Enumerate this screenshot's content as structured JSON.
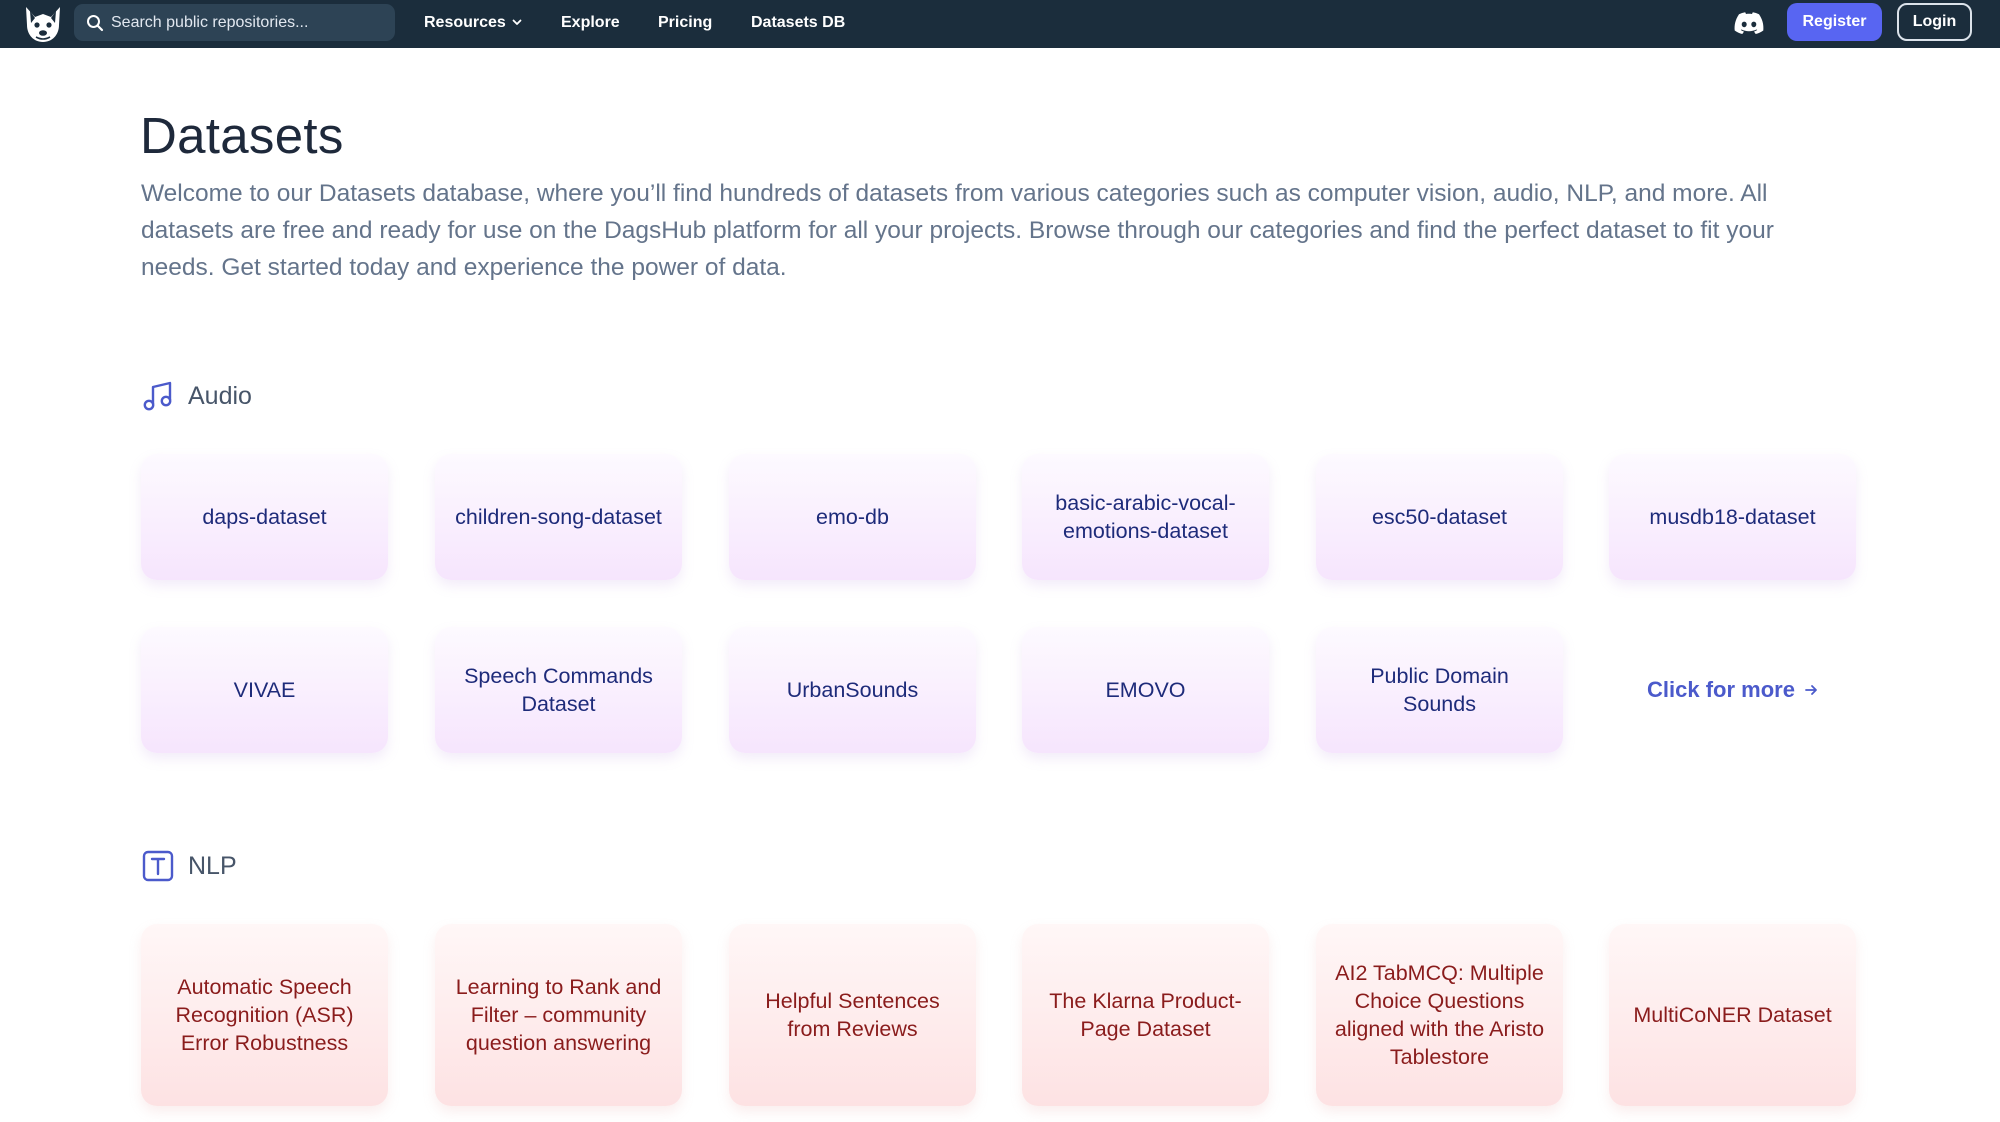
{
  "navbar": {
    "search_placeholder": "Search public repositories...",
    "links": [
      "Resources",
      "Explore",
      "Pricing",
      "Datasets DB"
    ],
    "register": "Register",
    "login": "Login"
  },
  "page": {
    "title": "Datasets",
    "intro": "Welcome to our Datasets database, where you’ll find hundreds of datasets from various categories such as computer vision, audio, NLP, and more. All datasets are free and ready for use on the DagsHub platform for all your projects. Browse through our categories and find the perfect dataset to fit your needs. Get started today and experience the power of data."
  },
  "sections": {
    "audio": {
      "label": "Audio",
      "items": [
        "daps-dataset",
        "children-song-dataset",
        "emo-db",
        "basic-arabic-vocal-emotions-dataset",
        "esc50-dataset",
        "musdb18-dataset",
        "VIVAE",
        "Speech Commands Dataset",
        "UrbanSounds",
        "EMOVO",
        "Public Domain Sounds"
      ],
      "more": "Click for more"
    },
    "nlp": {
      "label": "NLP",
      "items": [
        "Automatic Speech Recognition (ASR) Error Robustness",
        "Learning to Rank and Filter – community question answering",
        "Helpful Sentences from Reviews",
        "The Klarna Product-Page Dataset",
        "AI2 TabMCQ: Multiple Choice Questions aligned with the Aristo Tablestore",
        "MultiCoNER Dataset"
      ]
    }
  },
  "icons": {
    "logo": "dagshub-dog-logo",
    "search": "search-icon",
    "discord": "discord-icon",
    "audio": "music-note-icon",
    "nlp": "text-box-icon"
  },
  "colors": {
    "navbar_bg": "#1b2d3c",
    "accent": "#5865f2",
    "audio_card_text": "#1e2b7a",
    "nlp_card_text": "#8a1c1c",
    "link": "#4b5acb"
  }
}
